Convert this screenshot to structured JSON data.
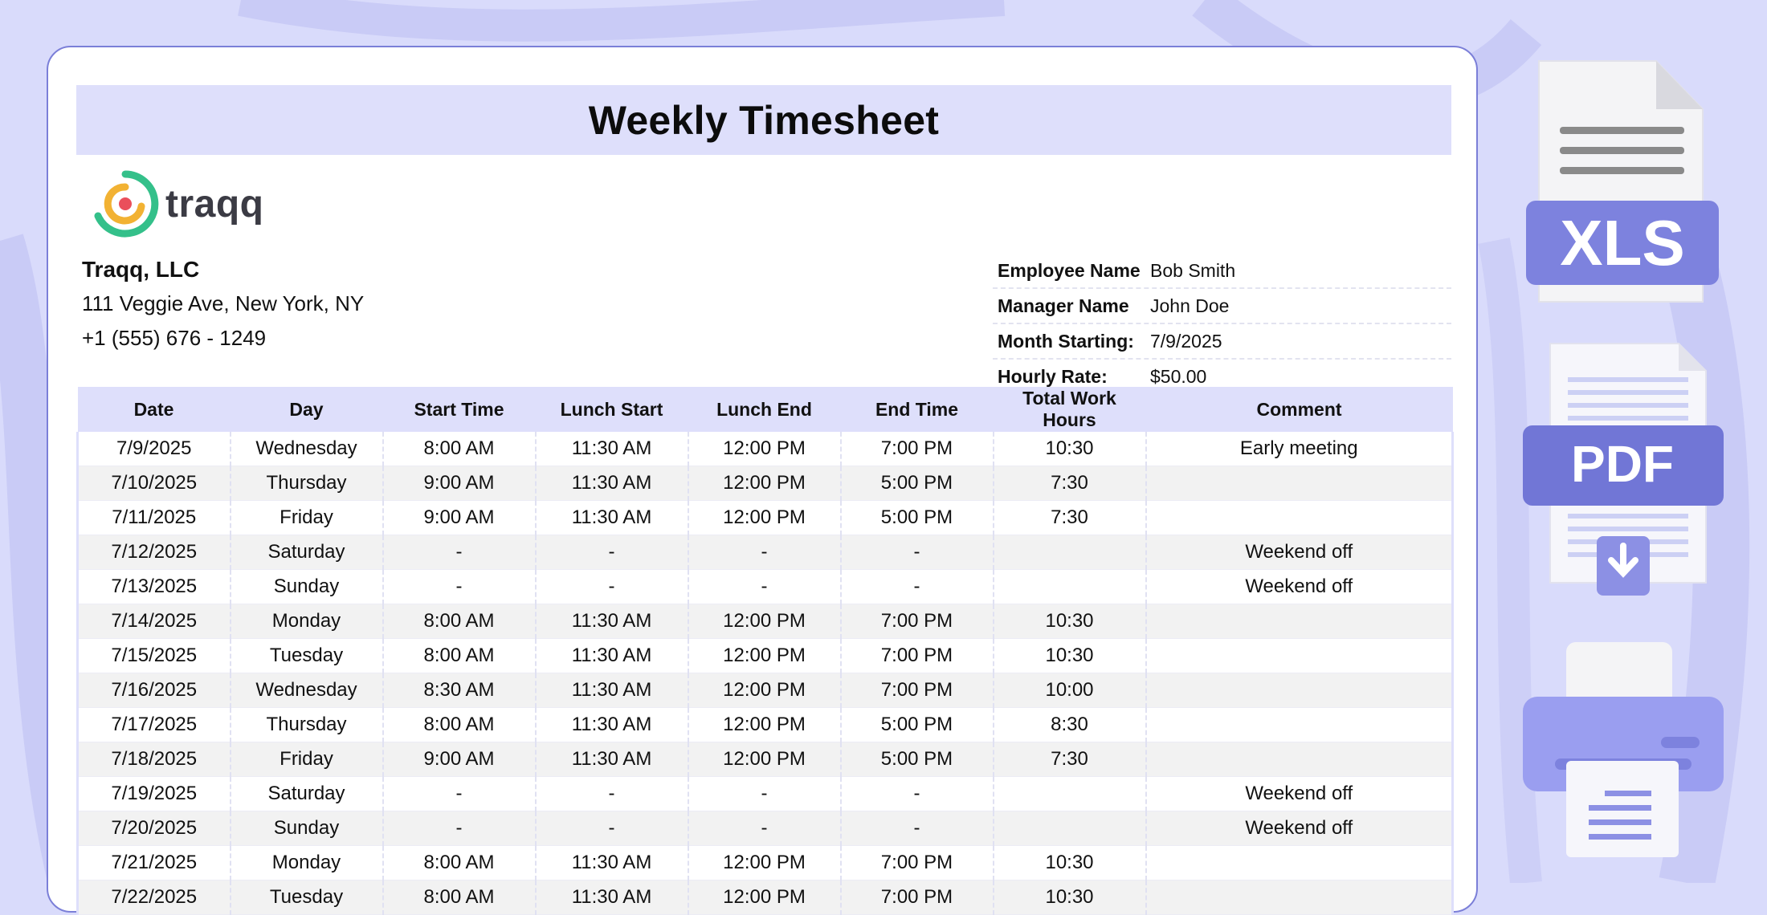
{
  "title": "Weekly Timesheet",
  "logo_text": "traqq",
  "company": {
    "name": "Traqq, LLC",
    "address": "111 Veggie Ave, New York, NY",
    "phone": "+1 (555) 676 - 1249"
  },
  "info": [
    {
      "label": "Employee Name",
      "value": "Bob Smith"
    },
    {
      "label": "Manager Name",
      "value": "John Doe"
    },
    {
      "label": "Month Starting:",
      "value": "7/9/2025"
    },
    {
      "label": "Hourly Rate:",
      "value": "$50.00"
    }
  ],
  "table": {
    "headers": [
      "Date",
      "Day",
      "Start Time",
      "Lunch Start",
      "Lunch End",
      "End Time",
      "Total Work Hours",
      "Comment"
    ],
    "rows": [
      [
        "7/9/2025",
        "Wednesday",
        "8:00 AM",
        "11:30 AM",
        "12:00 PM",
        "7:00 PM",
        "10:30",
        "Early meeting"
      ],
      [
        "7/10/2025",
        "Thursday",
        "9:00 AM",
        "11:30 AM",
        "12:00 PM",
        "5:00 PM",
        "7:30",
        ""
      ],
      [
        "7/11/2025",
        "Friday",
        "9:00 AM",
        "11:30 AM",
        "12:00 PM",
        "5:00 PM",
        "7:30",
        ""
      ],
      [
        "7/12/2025",
        "Saturday",
        "-",
        "-",
        "-",
        "-",
        "",
        "Weekend off"
      ],
      [
        "7/13/2025",
        "Sunday",
        "-",
        "-",
        "-",
        "-",
        "",
        "Weekend off"
      ],
      [
        "7/14/2025",
        "Monday",
        "8:00 AM",
        "11:30 AM",
        "12:00 PM",
        "7:00 PM",
        "10:30",
        ""
      ],
      [
        "7/15/2025",
        "Tuesday",
        "8:00 AM",
        "11:30 AM",
        "12:00 PM",
        "7:00 PM",
        "10:30",
        ""
      ],
      [
        "7/16/2025",
        "Wednesday",
        "8:30 AM",
        "11:30 AM",
        "12:00 PM",
        "7:00 PM",
        "10:00",
        ""
      ],
      [
        "7/17/2025",
        "Thursday",
        "8:00 AM",
        "11:30 AM",
        "12:00 PM",
        "5:00 PM",
        "8:30",
        ""
      ],
      [
        "7/18/2025",
        "Friday",
        "9:00 AM",
        "11:30 AM",
        "12:00 PM",
        "5:00 PM",
        "7:30",
        ""
      ],
      [
        "7/19/2025",
        "Saturday",
        "-",
        "-",
        "-",
        "-",
        "",
        "Weekend off"
      ],
      [
        "7/20/2025",
        "Sunday",
        "-",
        "-",
        "-",
        "-",
        "",
        "Weekend off"
      ],
      [
        "7/21/2025",
        "Monday",
        "8:00 AM",
        "11:30 AM",
        "12:00 PM",
        "7:00 PM",
        "10:30",
        ""
      ],
      [
        "7/22/2025",
        "Tuesday",
        "8:00 AM",
        "11:30 AM",
        "12:00 PM",
        "7:00 PM",
        "10:30",
        ""
      ]
    ]
  },
  "export_icons": [
    {
      "label": "XLS",
      "icon": "xls-file-icon"
    },
    {
      "label": "PDF",
      "icon": "pdf-download-icon"
    },
    {
      "label": "",
      "icon": "printer-icon"
    }
  ],
  "colors": {
    "accent": "#7b7fd8",
    "header_bg": "#dedffb",
    "page_bg": "#d9dbfb"
  }
}
